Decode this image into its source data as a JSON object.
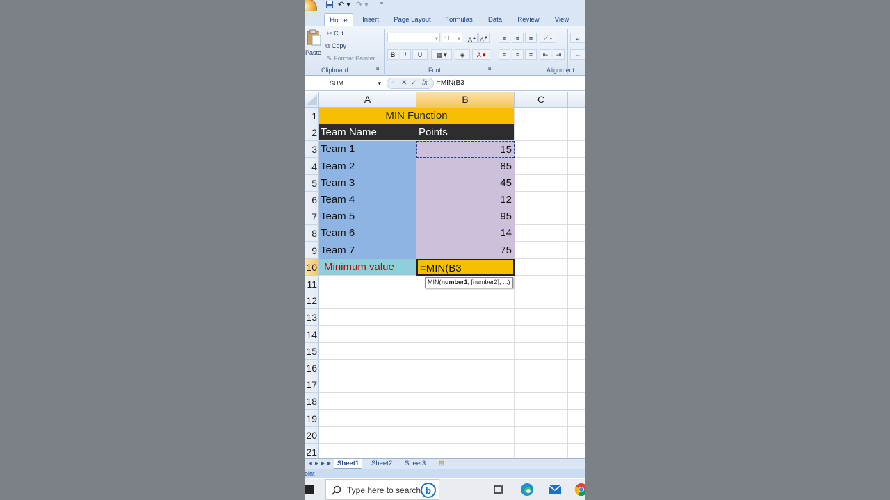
{
  "app": {
    "tabs": [
      {
        "label": "Home",
        "active": true
      },
      {
        "label": "Insert"
      },
      {
        "label": "Page Layout"
      },
      {
        "label": "Formulas"
      },
      {
        "label": "Data"
      },
      {
        "label": "Review"
      },
      {
        "label": "View"
      }
    ],
    "clipboard": {
      "paste": "Paste",
      "cut": "Cut",
      "copy": "Copy",
      "format_painter": "Format Painter",
      "group": "Clipboard"
    },
    "font": {
      "size": "11",
      "bold": "B",
      "italic": "I",
      "underline": "U",
      "group": "Font"
    },
    "alignment": {
      "group": "Alignment"
    }
  },
  "formula_bar": {
    "name_box": "SUM",
    "cancel": "✕",
    "enter": "✓",
    "fx": "fx",
    "content": "=MIN(B3"
  },
  "grid": {
    "columns": [
      "A",
      "B",
      "C"
    ],
    "rows": [
      {
        "n": "1",
        "a": "MIN Function",
        "b": ""
      },
      {
        "n": "2",
        "a": "Team Name",
        "b": "Points"
      },
      {
        "n": "3",
        "a": "Team 1",
        "b": "15"
      },
      {
        "n": "4",
        "a": "Team 2",
        "b": "85"
      },
      {
        "n": "5",
        "a": "Team 3",
        "b": "45"
      },
      {
        "n": "6",
        "a": "Team 4",
        "b": "12"
      },
      {
        "n": "7",
        "a": "Team 5",
        "b": "95"
      },
      {
        "n": "8",
        "a": "Team 6",
        "b": "14"
      },
      {
        "n": "9",
        "a": "Team 7",
        "b": "75"
      },
      {
        "n": "10",
        "a": "Minimum value",
        "b": "=MIN(B3"
      },
      {
        "n": "11"
      },
      {
        "n": "12"
      },
      {
        "n": "13"
      },
      {
        "n": "14"
      },
      {
        "n": "15"
      },
      {
        "n": "16"
      },
      {
        "n": "17"
      },
      {
        "n": "18"
      },
      {
        "n": "19"
      },
      {
        "n": "20"
      },
      {
        "n": "21"
      }
    ],
    "tooltip_fn": "MIN(",
    "tooltip_arg1": "number1",
    "tooltip_rest": ", [number2], ...)"
  },
  "sheets": [
    "Sheet1",
    "Sheet2",
    "Sheet3"
  ],
  "status": "oint",
  "taskbar": {
    "search_placeholder": "Type here to search"
  },
  "colors": {
    "title_fill": "#f5c000",
    "header_fill": "#2d2d2d",
    "team_fill": "#8db4e2",
    "points_fill": "#ccc0da",
    "min_label_fill": "#92cddc",
    "min_label_text": "#c00000",
    "active_cell_fill": "#f5c000"
  }
}
